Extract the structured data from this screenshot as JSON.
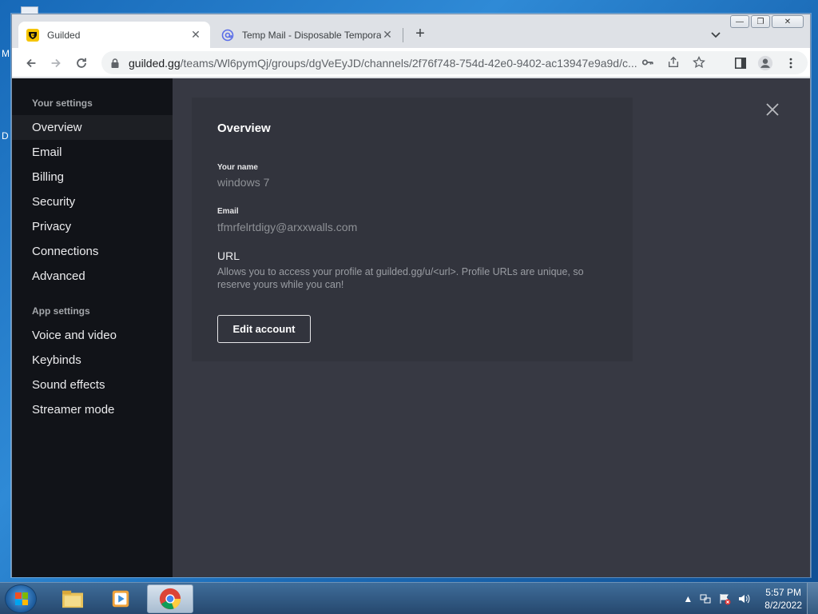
{
  "desktop": {
    "labels": [
      "M",
      "D"
    ]
  },
  "browser": {
    "tabs": [
      {
        "title": "Guilded",
        "active": true
      },
      {
        "title": "Temp Mail - Disposable Tempora",
        "active": false
      }
    ],
    "new_tab": "+",
    "omnibox": {
      "host": "guilded.gg",
      "path": "/teams/Wl6pymQj/groups/dgVeEyJD/channels/2f76f748-754d-42e0-9402-ac13947e9a9d/c..."
    }
  },
  "sidebar": {
    "your_settings_title": "Your settings",
    "your_settings_items": [
      {
        "label": "Overview",
        "active": true
      },
      {
        "label": "Email"
      },
      {
        "label": "Billing"
      },
      {
        "label": "Security"
      },
      {
        "label": "Privacy"
      },
      {
        "label": "Connections"
      },
      {
        "label": "Advanced"
      }
    ],
    "app_settings_title": "App settings",
    "app_settings_items": [
      {
        "label": "Voice and video"
      },
      {
        "label": "Keybinds"
      },
      {
        "label": "Sound effects"
      },
      {
        "label": "Streamer mode"
      }
    ]
  },
  "overview": {
    "heading": "Overview",
    "name_label": "Your name",
    "name_value": "windows 7",
    "email_label": "Email",
    "email_value": "tfmrfelrtdigy@arxxwalls.com",
    "url_heading": "URL",
    "url_description": "Allows you to access your profile at guilded.gg/u/<url>. Profile URLs are unique, so reserve yours while you can!",
    "edit_button": "Edit account"
  },
  "taskbar": {
    "time": "5:57 PM",
    "date": "8/2/2022"
  },
  "colors": {
    "sidebar_bg": "#111318",
    "main_bg": "#373943",
    "card_bg": "#32343d",
    "guilded_yellow": "#f5c400"
  }
}
